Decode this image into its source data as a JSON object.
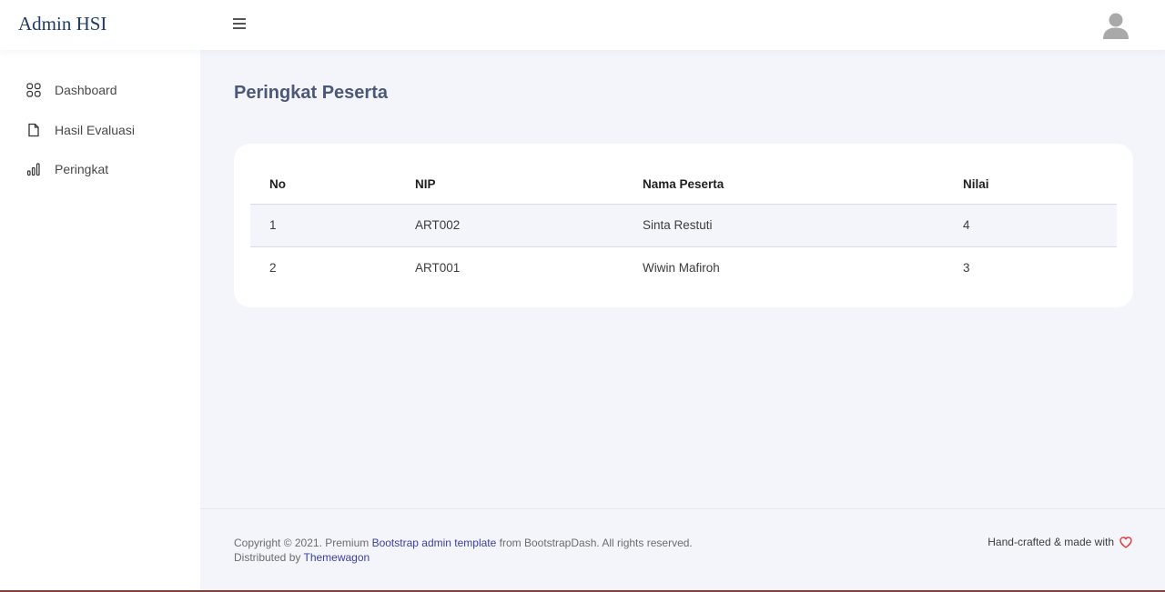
{
  "brand": "Admin HSI",
  "sidebar": {
    "items": [
      {
        "label": "Dashboard",
        "icon": "grid-icon"
      },
      {
        "label": "Hasil Evaluasi",
        "icon": "file-icon"
      },
      {
        "label": "Peringkat",
        "icon": "bar-chart-icon"
      }
    ]
  },
  "page": {
    "title": "Peringkat Peserta"
  },
  "table": {
    "headers": [
      "No",
      "NIP",
      "Nama Peserta",
      "Nilai"
    ],
    "rows": [
      [
        "1",
        "ART002",
        "Sinta Restuti",
        "4"
      ],
      [
        "2",
        "ART001",
        "Wiwin Mafiroh",
        "3"
      ]
    ]
  },
  "footer": {
    "copyright_prefix": "Copyright © 2021. Premium ",
    "template_link": "Bootstrap admin template",
    "copyright_suffix": " from BootstrapDash. All rights reserved.",
    "distributed_prefix": "Distributed by ",
    "themewagon_link": "Themewagon",
    "right_text": "Hand-crafted & made with"
  },
  "colors": {
    "brand": "#1f3b6b",
    "background": "#f4f5fb",
    "title": "#4b5877",
    "link": "#3a3fa7",
    "heart": "#e53935"
  }
}
